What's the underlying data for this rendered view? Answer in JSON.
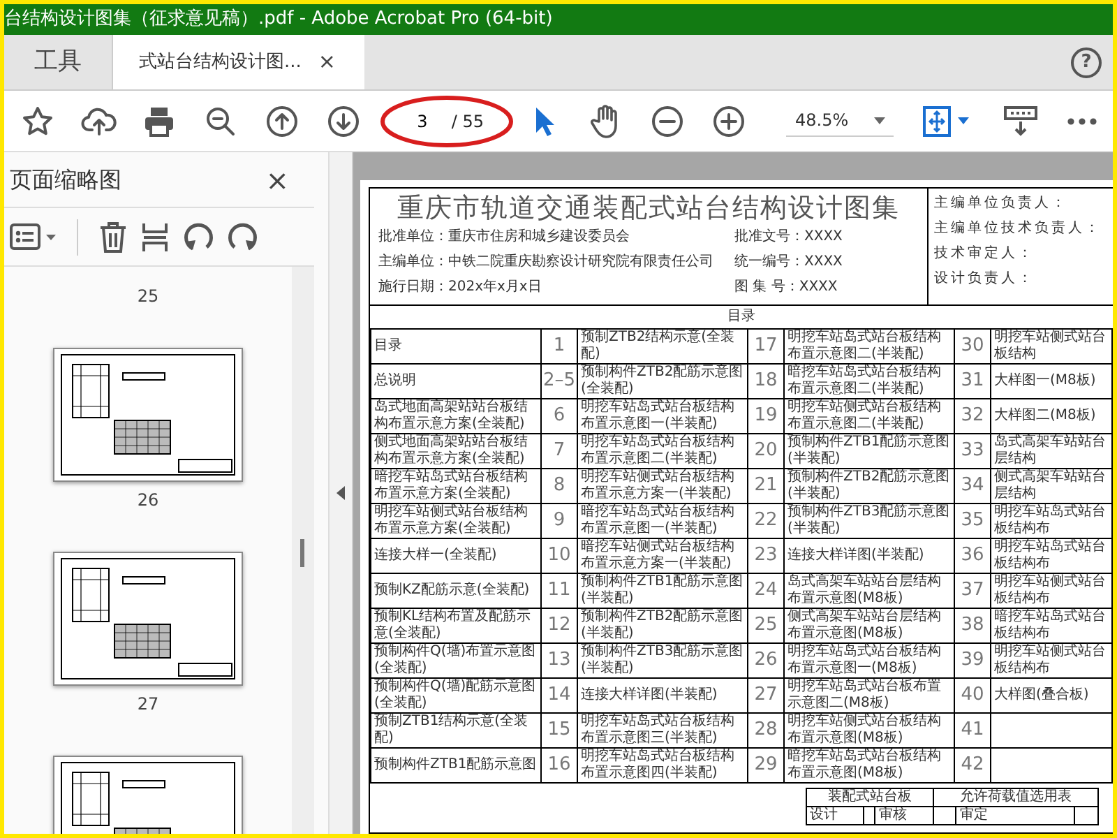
{
  "window": {
    "title": "台结构设计图集（征求意见稿）.pdf - Adobe Acrobat Pro (64-bit)"
  },
  "tabs": [
    {
      "label": "工具",
      "kind": "tools",
      "selected": false
    },
    {
      "label": "式站台结构设计图...",
      "kind": "document",
      "selected": true,
      "close": "×"
    }
  ],
  "help": "?",
  "toolbar": {
    "page_number": "3",
    "page_total": "/ 55",
    "zoom": "48.5%",
    "tools": [
      {
        "kind": "select",
        "selected": true
      },
      {
        "kind": "hand",
        "selected": false
      }
    ]
  },
  "sidebar": {
    "title": "页面缩略图",
    "close": "×",
    "items": [
      {
        "kind": "label",
        "text": "25"
      },
      {
        "kind": "thumbnail"
      },
      {
        "kind": "label",
        "text": "26"
      },
      {
        "kind": "thumbnail"
      },
      {
        "kind": "label",
        "text": "27"
      },
      {
        "kind": "thumbnail"
      }
    ]
  },
  "document": {
    "title": "重庆市轨道交通装配式站台结构设计图集",
    "info": [
      [
        "批准单位：重庆市住房和城乡建设委员会",
        "批准文号：XXXX"
      ],
      [
        "主编单位：中铁二院重庆勘察设计研究院有限责任公司",
        "统一编号：XXXX"
      ],
      [
        "施行日期：202x年x月x日",
        "图 集 号：XXXX"
      ]
    ],
    "signatures": [
      "主编单位负责人：",
      "主编单位技术负责人：",
      "技术审定人：",
      "设计负责人："
    ],
    "toc_heading": "目录",
    "toc_rows": [
      [
        "目录",
        "1",
        "预制ZTB2结构示意(全装配)",
        "17",
        "明挖车站岛式站台板结构布置示意图二(半装配)",
        "30",
        "明挖车站侧式站台板结构"
      ],
      [
        "总说明",
        "2–5",
        "预制构件ZTB2配筋示意图(全装配)",
        "18",
        "暗挖车站岛式站台板结构布置示意图二(半装配)",
        "31",
        "大样图一(M8板)"
      ],
      [
        "岛式地面高架站站台板结构布置示意方案(全装配)",
        "6",
        "明挖车站岛式站台板结构布置示意图一(半装配)",
        "19",
        "明挖车站侧式站台板结构布置示意图二(半装配)",
        "32",
        "大样图二(M8板)"
      ],
      [
        "侧式地面高架站站台板结构布置示意方案(全装配)",
        "7",
        "明挖车站岛式站台板结构布置示意图二(半装配)",
        "20",
        "预制构件ZTB1配筋示意图(半装配)",
        "33",
        "岛式高架车站站台层结构"
      ],
      [
        "暗挖车站岛式站台板结构布置示意方案(全装配)",
        "8",
        "明挖车站侧式站台板结构布置示意方案一(半装配)",
        "21",
        "预制构件ZTB2配筋示意图(半装配)",
        "34",
        "侧式高架车站站台层结构"
      ],
      [
        "明挖车站侧式站台板结构布置示意方案(全装配)",
        "9",
        "暗挖车站岛式站台板结构布置示意图一(半装配)",
        "22",
        "预制构件ZTB3配筋示意图(半装配)",
        "35",
        "明挖车站岛式站台板结构布"
      ],
      [
        "连接大样一(全装配)",
        "10",
        "暗挖车站侧式站台板结构布置示意方案一(半装配)",
        "23",
        "连接大样详图(半装配)",
        "36",
        "明挖车站岛式站台板结构布"
      ],
      [
        "预制KZ配筋示意(全装配)",
        "11",
        "预制构件ZTB1配筋示意图(半装配)",
        "24",
        "岛式高架车站站台层结构布置示意图(M8板)",
        "37",
        "明挖车站侧式站台板结构布"
      ],
      [
        "预制KL结构布置及配筋示意(全装配)",
        "12",
        "预制构件ZTB2配筋示意图(半装配)",
        "25",
        "侧式高架车站站台层结构布置示意图(M8板)",
        "38",
        "暗挖车站岛式站台板结构布"
      ],
      [
        "预制构件Q(墙)布置示意图(全装配)",
        "13",
        "预制构件ZTB3配筋示意图(半装配)",
        "26",
        "明挖车站岛式站台板结构布置示意图一(M8板)",
        "39",
        "明挖车站侧式站台板结构布"
      ],
      [
        "预制构件Q(墙)配筋示意图(全装配)",
        "14",
        "连接大样详图(半装配)",
        "27",
        "明挖车站岛式站台板布置示意图二(M8板)",
        "40",
        "大样图(叠合板)"
      ],
      [
        "预制ZTB1结构示意(全装配)",
        "15",
        "明挖车站岛式站台板结构布置示意图三(半装配)",
        "28",
        "明挖车站侧式站台板结构布置示意图(M8板)",
        "41",
        null
      ],
      [
        "预制构件ZTB1配筋示意图",
        "16",
        "明挖车站岛式站台板结构布置示意图四(半装配)",
        "29",
        "暗挖车站岛式站台板结构布置示意图(M8板)",
        "42",
        null
      ]
    ],
    "footer": {
      "name": "装配式站台板",
      "sheet": "允许荷载值选用表",
      "roles": [
        "设计",
        "审核",
        "审定"
      ]
    }
  }
}
